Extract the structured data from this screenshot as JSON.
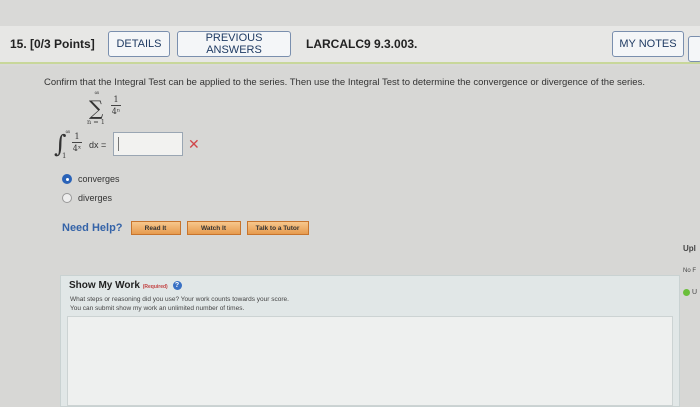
{
  "question": {
    "title": "15. [0/3 Points]",
    "details_label": "DETAILS",
    "previous_answers_label": "PREVIOUS ANSWERS",
    "code": "LARCALC9 9.3.003.",
    "my_notes_label": "MY NOTES"
  },
  "problem": {
    "prompt": "Confirm that the Integral Test can be applied to the series. Then use the Integral Test to determine the convergence or divergence of the series.",
    "series_upper": "∞",
    "series_num": "1",
    "series_den": "4ⁿ",
    "series_lower": "n = 1",
    "integral_upper": "∞",
    "integral_lower": "1",
    "integrand_num": "1",
    "integrand_den": "4ˣ",
    "dx_label": "dx =",
    "answer_value": "",
    "wrong_mark": "✕"
  },
  "options": [
    {
      "label": "converges",
      "selected": true
    },
    {
      "label": "diverges",
      "selected": false
    }
  ],
  "help": {
    "label": "Need Help?",
    "read_it": "Read It",
    "watch_it": "Watch It",
    "talk_to_tutor": "Talk to a Tutor"
  },
  "show_my_work": {
    "title": "Show My Work",
    "required": "(Required)",
    "line1": "What steps or reasoning did you use? Your work counts towards your score.",
    "line2": "You can submit show my work an unlimited number of times.",
    "help_icon": "?"
  },
  "side": {
    "upload": "Upl",
    "no_file": "No F",
    "u": "U"
  },
  "colors": {
    "accent_blue": "#2a63b8",
    "wrong_red": "#d0464a",
    "help_button_orange": "#e69a4e",
    "header_underline": "#c8d79a"
  }
}
